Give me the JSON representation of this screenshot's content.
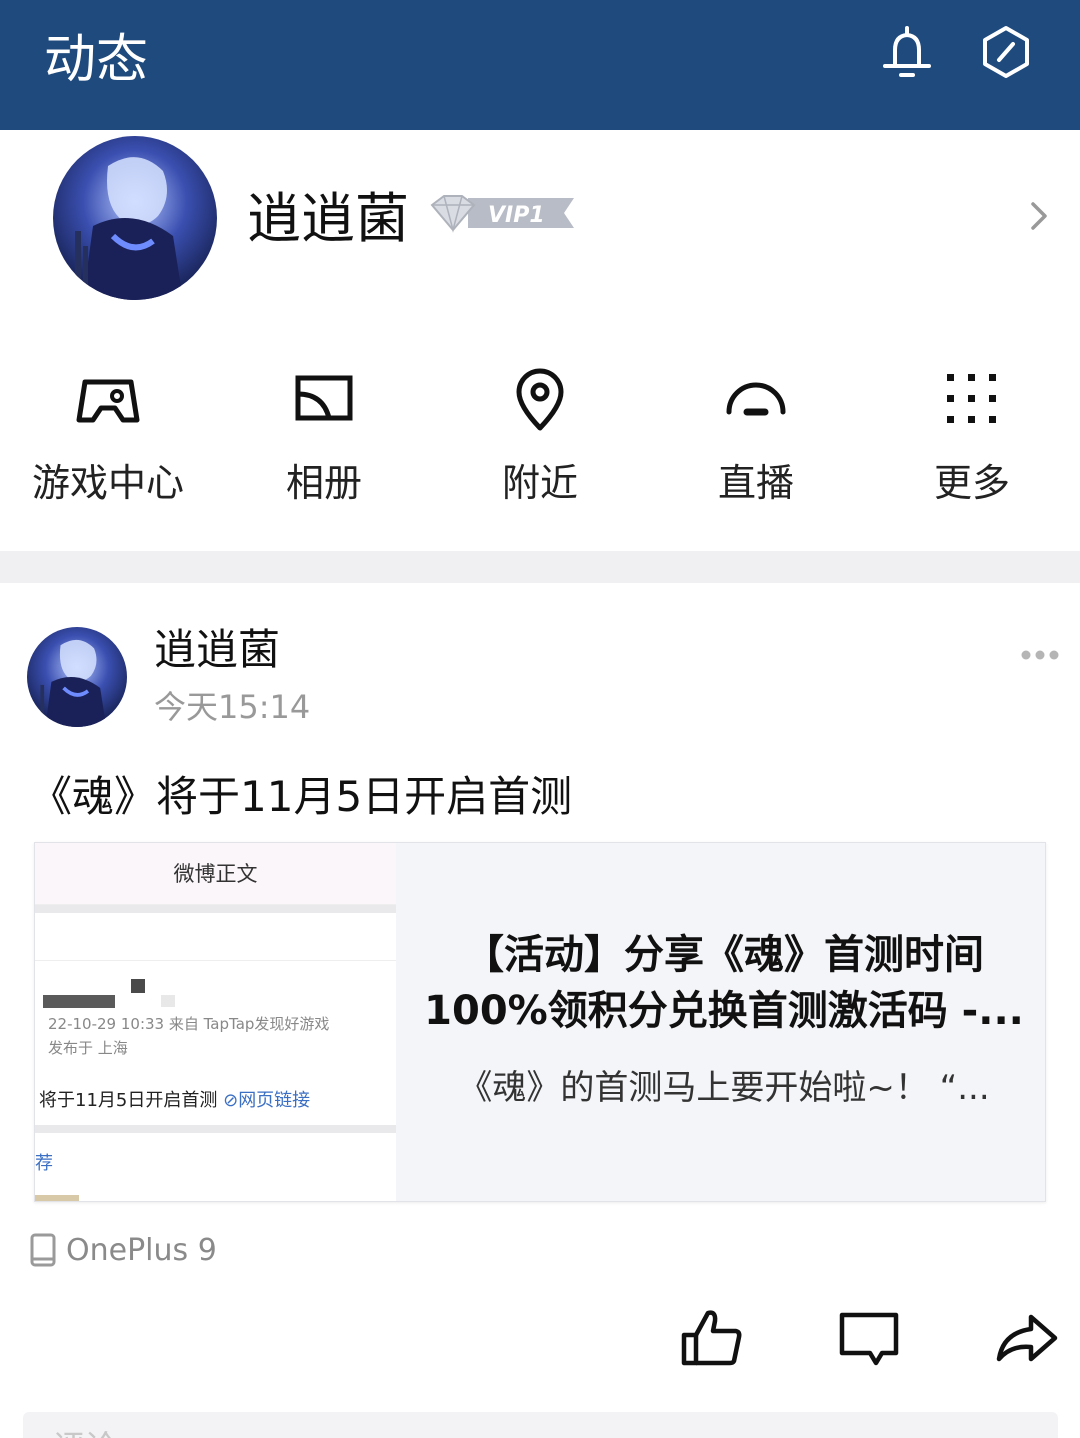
{
  "header": {
    "title": "动态",
    "icons": [
      "bell-icon",
      "hexagon-badge-icon"
    ],
    "background_color": "#1e4a7e"
  },
  "profile": {
    "name": "逍逍菌",
    "vip_label": "VIP1"
  },
  "quick_actions": [
    {
      "label": "游戏中心",
      "icon": "gamepad-icon"
    },
    {
      "label": "相册",
      "icon": "album-icon"
    },
    {
      "label": "附近",
      "icon": "location-pin-icon"
    },
    {
      "label": "直播",
      "icon": "live-icon"
    },
    {
      "label": "更多",
      "icon": "grid-dots-icon"
    }
  ],
  "post": {
    "author": "逍逍菌",
    "time": "今天15:14",
    "text": "《魂》将于11月5日开启首测",
    "card": {
      "thumb_header": "微博正文",
      "thumb_meta1": "22-10-29 10:33  来自 TapTap发现好游戏",
      "thumb_meta2": "发布于 上海",
      "thumb_line": "将于11月5日开启首测",
      "thumb_link": "网页链接",
      "thumb_rec": "荐",
      "title": "【活动】分享《魂》首测时间100%领积分兑换首测激活码 -...",
      "description": "《魂》的首测马上要开始啦~！ “..."
    },
    "device": "OnePlus 9",
    "comment_placeholder": "评论"
  }
}
